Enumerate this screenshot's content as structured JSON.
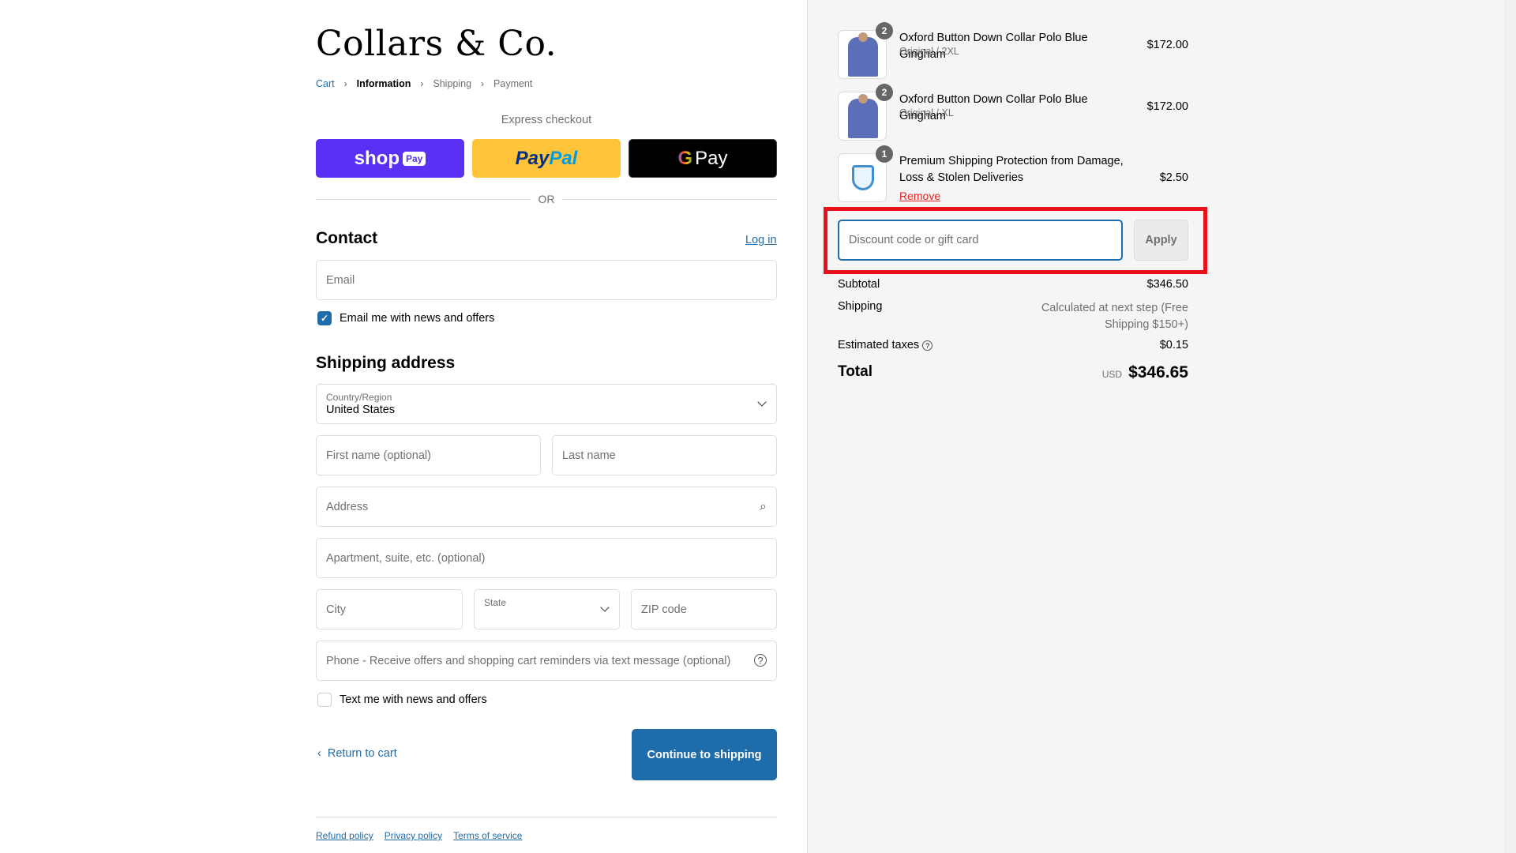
{
  "brand": {
    "name": "Collars & Co."
  },
  "breadcrumb": [
    "Cart",
    "Information",
    "Shipping",
    "Payment"
  ],
  "express": {
    "title": "Express checkout",
    "shop_pay": "shop",
    "shop_pay_tag": "Pay",
    "paypal_a": "Pay",
    "paypal_b": "Pal",
    "gpay": "Pay",
    "gpay_g": "G",
    "or": "OR"
  },
  "contact": {
    "heading": "Contact",
    "login": "Log in",
    "email_placeholder": "Email",
    "email_news_label": "Email me with news and offers",
    "email_news_checked": true
  },
  "shipping": {
    "heading": "Shipping address",
    "country_label": "Country/Region",
    "country_value": "United States",
    "first_name_placeholder": "First name (optional)",
    "last_name_placeholder": "Last name",
    "address_placeholder": "Address",
    "apartment_placeholder": "Apartment, suite, etc. (optional)",
    "city_placeholder": "City",
    "state_label": "State",
    "zip_placeholder": "ZIP code",
    "phone_placeholder": "Phone - Receive offers and shopping cart reminders via text message (optional)",
    "text_news_label": "Text me with news and offers",
    "text_news_checked": false
  },
  "actions": {
    "return": "Return to cart",
    "continue": "Continue to shipping"
  },
  "footer": {
    "links": [
      "Refund policy",
      "Privacy policy",
      "Terms of service"
    ]
  },
  "order": {
    "items": [
      {
        "name": "Oxford Button Down Collar Polo Blue Gingham",
        "variant": "Original / 2XL",
        "price": "$172.00",
        "qty": "2"
      },
      {
        "name": "Oxford Button Down Collar Polo Blue Gingham",
        "variant": "Original / XL",
        "price": "$172.00",
        "qty": "2"
      },
      {
        "name": "Premium Shipping Protection from Damage, Loss & Stolen Deliveries",
        "price": "$2.50",
        "qty": "1",
        "remove": "Remove"
      }
    ],
    "discount_placeholder": "Discount code or gift card",
    "apply": "Apply",
    "subtotal_label": "Subtotal",
    "subtotal": "$346.50",
    "shipping_label": "Shipping",
    "shipping_value": "Calculated at next step (Free Shipping $150+)",
    "taxes_label": "Estimated taxes",
    "taxes": "$0.15",
    "total_label": "Total",
    "currency": "USD",
    "total": "$346.65"
  },
  "colors": {
    "accent": "#1f6cab",
    "highlight": "#e8121a",
    "shop_pay": "#5a31f4",
    "paypal": "#ffc439"
  }
}
